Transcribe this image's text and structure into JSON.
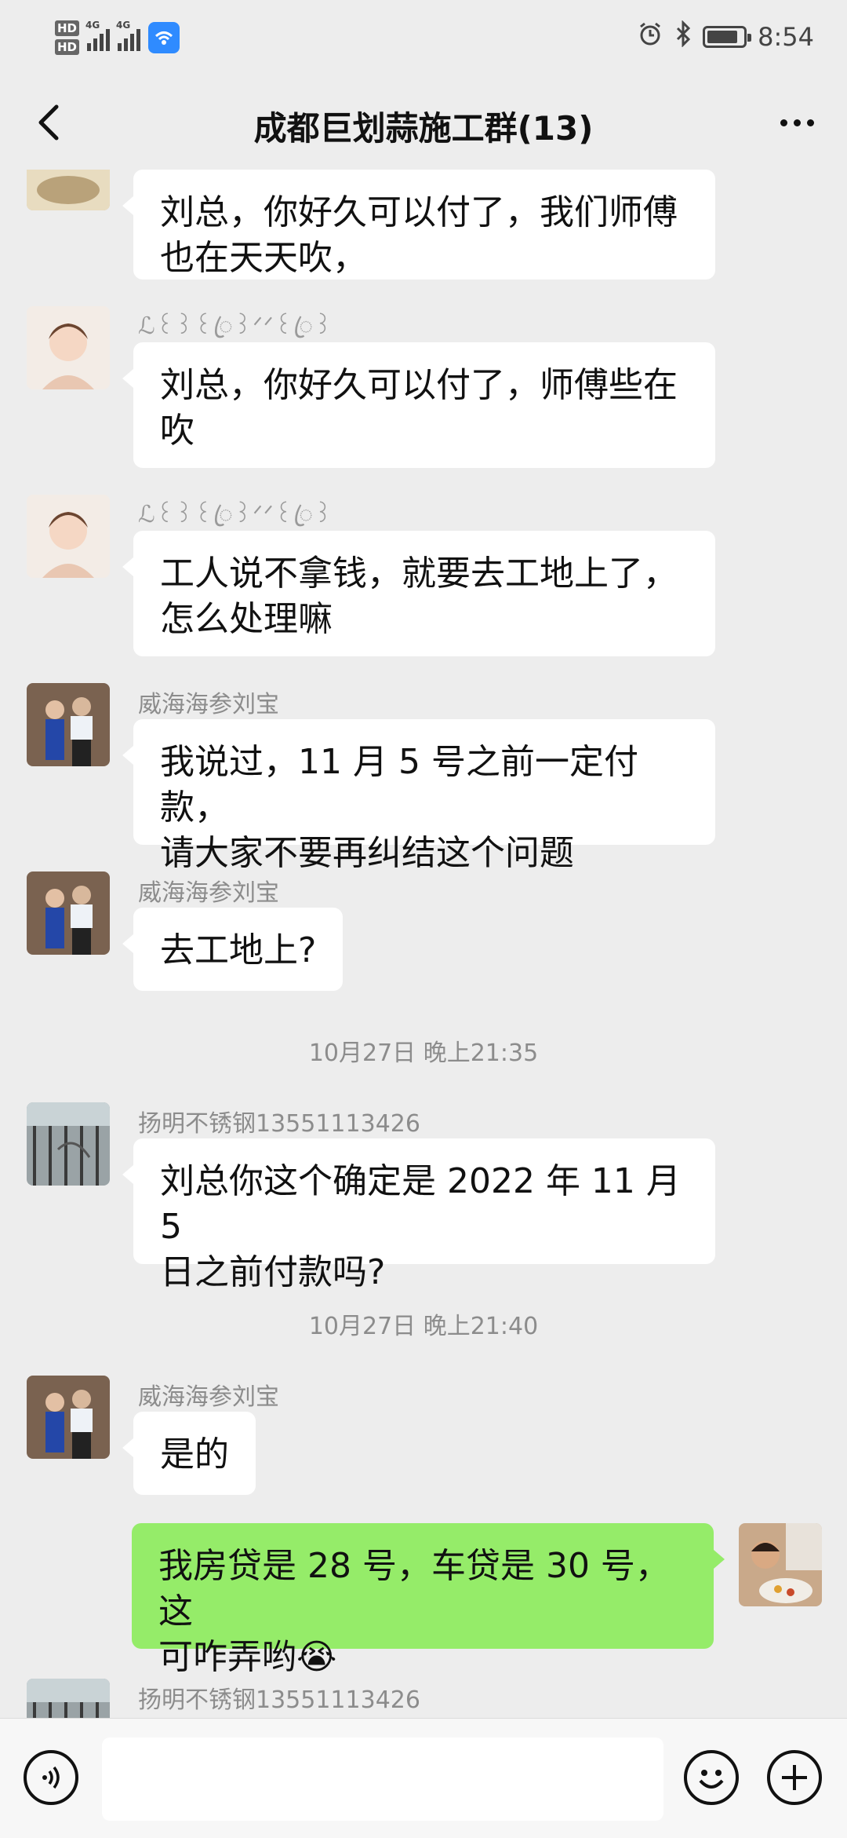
{
  "status_bar": {
    "time": "8:54",
    "network_1": "4G",
    "network_2": "4G",
    "hd_1": "HD",
    "hd_2": "HD",
    "battery_level": 0.85
  },
  "header": {
    "title": "成都巨划蒜施工群(13)"
  },
  "messages": {
    "m0": {
      "text": "刘总，你好久可以付了，我们师傅\n也在天天吹，"
    },
    "m1": {
      "sender": "ℒ꒰꒱꒰ꦿ꒱ᐟᐟ꒰ꦿ꒱",
      "text": "刘总，你好久可以付了，师傅些在\n吹"
    },
    "m2": {
      "sender": "ℒ꒰꒱꒰ꦿ꒱ᐟᐟ꒰ꦿ꒱",
      "text": "工人说不拿钱，就要去工地上了，\n怎么处理嘛"
    },
    "m3": {
      "sender": "威海海参刘宝",
      "text": "我说过，11 月 5 号之前一定付款，\n请大家不要再纠结这个问题"
    },
    "m4": {
      "sender": "威海海参刘宝",
      "text": "去工地上?"
    },
    "ts1": "10月27日 晚上21:35",
    "m5": {
      "sender": "扬明不锈钢13551113426",
      "text": "刘总你这个确定是 2022 年 11 月 5\n日之前付款吗?"
    },
    "ts2": "10月27日 晚上21:40",
    "m6": {
      "sender": "威海海参刘宝",
      "text": "是的"
    },
    "m7": {
      "text": "我房贷是 28 号，车贷是 30 号，这\n可咋弄哟😭"
    },
    "m8": {
      "sender": "扬明不锈钢13551113426"
    }
  },
  "input": {
    "placeholder": ""
  },
  "icons": {
    "back": "chevron-left-icon",
    "more": "more-dots-icon",
    "voice": "voice-icon",
    "emoji": "emoji-icon",
    "add": "plus-icon"
  },
  "colors": {
    "background": "#ededed",
    "bubble_left": "#ffffff",
    "bubble_right": "#95ec69",
    "wifi": "#2f8bff"
  }
}
